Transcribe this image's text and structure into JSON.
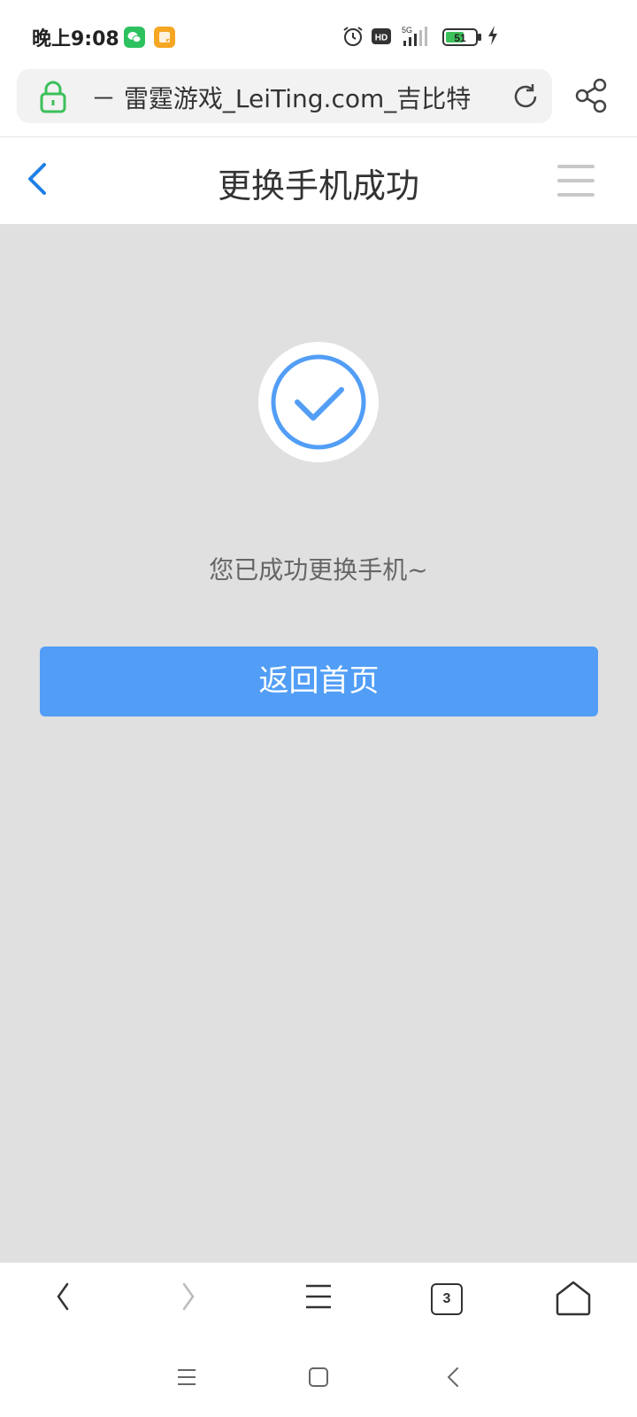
{
  "status_bar": {
    "time": "晚上9:08",
    "hd": "HD",
    "network": "5G",
    "battery": "51"
  },
  "address_bar": {
    "url_text": "－ 雷霆游戏_LeiTing.com_吉比特"
  },
  "header": {
    "title": "更换手机成功"
  },
  "content": {
    "message": "您已成功更换手机~",
    "home_button": "返回首页"
  },
  "toolbar": {
    "tab_count": "3"
  },
  "colors": {
    "accent": "#529ef6",
    "back_arrow": "#1f7fe5",
    "lock": "#3cc05a",
    "background": "#e0e0e0"
  },
  "icons": [
    "wechat-icon",
    "note-app-icon",
    "alarm-icon",
    "signal-icon",
    "battery-icon",
    "charging-icon",
    "lock-icon",
    "reload-icon",
    "share-icon",
    "back-arrow-icon",
    "menu-icon",
    "check-circle-icon",
    "browser-back-icon",
    "browser-forward-icon",
    "browser-menu-icon",
    "tabs-icon",
    "home-icon",
    "recents-icon",
    "system-home-icon",
    "system-back-icon"
  ]
}
